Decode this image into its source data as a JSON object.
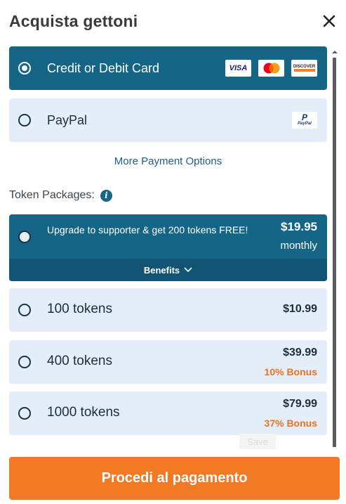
{
  "header": {
    "title": "Acquista gettoni",
    "close_icon": "close-icon"
  },
  "payment_methods": [
    {
      "label": "Credit or Debit Card",
      "selected": true,
      "icons": [
        "visa-icon",
        "mastercard-icon",
        "discover-icon"
      ],
      "visa_text": "VISA",
      "discover_text": "DISCOVER"
    },
    {
      "label": "PayPal",
      "selected": false,
      "icons": [
        "paypal-icon"
      ],
      "paypal_text": "PayPal"
    }
  ],
  "more_options": "More Payment Options",
  "token_section": {
    "label": "Token Packages:",
    "info_icon": "info-icon"
  },
  "supporter": {
    "text": "Upgrade to supporter & get 200 tokens FREE!",
    "price": "$19.95",
    "period": "monthly",
    "benefits_label": "Benefits",
    "selected": true
  },
  "packages": [
    {
      "label": "100 tokens",
      "price": "$10.99",
      "bonus": ""
    },
    {
      "label": "400 tokens",
      "price": "$39.99",
      "bonus": "10% Bonus"
    },
    {
      "label": "1000 tokens",
      "price": "$79.99",
      "bonus": "37% Bonus"
    }
  ],
  "ghost_save": "Save",
  "cta": {
    "label": "Procedi al pagamento"
  },
  "colors": {
    "primary": "#156587",
    "accent": "#f37a25",
    "light_bg": "#e3eef9",
    "bonus": "#e87324"
  }
}
